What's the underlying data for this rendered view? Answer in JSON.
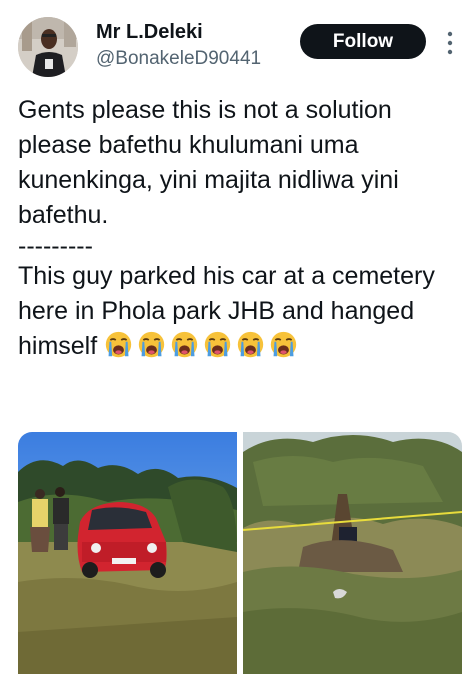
{
  "author": {
    "display_name": "Mr L.Deleki",
    "handle": "@BonakeleD90441",
    "avatar_icon": "avatar-photo"
  },
  "actions": {
    "follow_label": "Follow",
    "more_icon": "more-vertical-icon"
  },
  "tweet": {
    "paragraph_1": "Gents please this is not a solution please bafethu khulumani uma kunenkinga, yini majita nidliwa yini bafethu.",
    "divider": "---------",
    "paragraph_2": "This guy parked his car at a cemetery here in Phola park JHB and hanged himself",
    "emoji_name": "loudly-crying-face",
    "emoji_count": 6
  },
  "media": {
    "images": [
      {
        "name": "photo-red-car-cemetery"
      },
      {
        "name": "photo-tree-scene"
      }
    ]
  },
  "colors": {
    "text": "#0f1419",
    "secondary": "#536471",
    "button_bg": "#0f1419",
    "button_text": "#ffffff",
    "emoji_yellow": "#f7c23a",
    "tear_blue": "#4d9de0"
  }
}
